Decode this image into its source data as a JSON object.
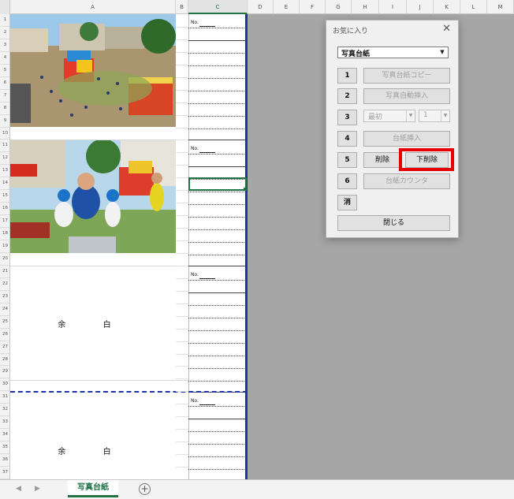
{
  "columns": [
    "A",
    "B",
    "C",
    "D",
    "E",
    "F",
    "G",
    "H",
    "I",
    "J",
    "K",
    "L",
    "M"
  ],
  "rows": [
    "1",
    "2",
    "3",
    "4",
    "5",
    "6",
    "7",
    "8",
    "9",
    "10",
    "11",
    "12",
    "13",
    "14",
    "15",
    "16",
    "17",
    "18",
    "19",
    "20",
    "21",
    "22",
    "23",
    "24",
    "25",
    "26",
    "27",
    "28",
    "29",
    "30",
    "31",
    "32",
    "33",
    "34",
    "35",
    "36",
    "37"
  ],
  "sheet": {
    "no_label": "No.",
    "blank_label": "余 白",
    "tab_name": "写真台紙",
    "add_sheet": "+",
    "nav_prev": "◀",
    "nav_next": "▶"
  },
  "dialog": {
    "title": "お気に入り",
    "close": "✕",
    "selected_template": "写真台紙",
    "buttons": {
      "b1": "1",
      "b2": "2",
      "b3": "3",
      "b4": "4",
      "b5": "5",
      "b6": "6",
      "clear": "消",
      "copy_sheet": "写真台紙コピー",
      "auto_insert": "写真自動挿入",
      "insert_sheet": "台紙挿入",
      "delete": "削除",
      "delete_below": "下削除",
      "counter": "台紙カウンタ",
      "close": "閉じる"
    },
    "combo_start": "最初",
    "combo_num": "1"
  }
}
